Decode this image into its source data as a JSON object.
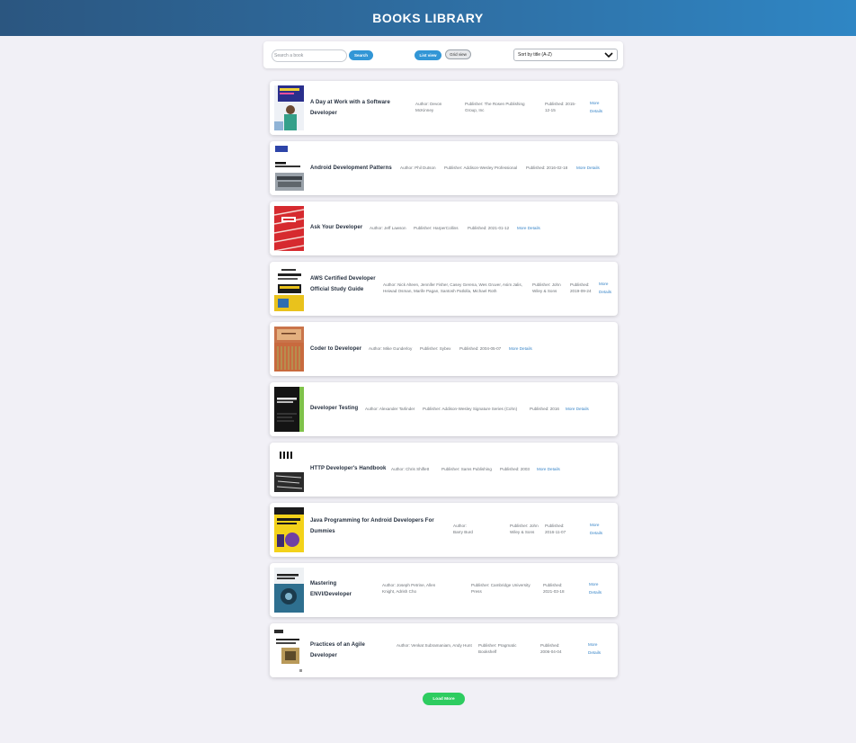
{
  "header": {
    "title": "BOOKS LIBRARY"
  },
  "toolbar": {
    "search_placeholder": "Search a book",
    "search_button": "Search",
    "list_view": "List view",
    "grid_view": "Grid view",
    "sort_selected": "Sort by title (A-Z)"
  },
  "books": [
    {
      "title": "A Day at Work with a Software Developer",
      "author": "Author: Devon McKinney",
      "publisher": "Publisher: The Rosen Publishing Group, Inc",
      "published": "Published: 2015-12-15",
      "more": "More Details"
    },
    {
      "title": "Android Development Patterns",
      "author": "Author: Phil Dutson",
      "publisher": "Publisher: Addison-Wesley Professional",
      "published": "Published: 2016-02-18",
      "more": "More Details"
    },
    {
      "title": "Ask Your Developer",
      "author": "Author: Jeff Lawson",
      "publisher": "Publisher: HarperCollins",
      "published": "Published: 2021-01-12",
      "more": "More Details"
    },
    {
      "title": "AWS Certified Developer Official Study Guide",
      "author": "Author: Nick Alteen, Jennifer Fisher, Casey Gerena, Wes Gruver, Asim Jalis, Heiwad Osman, Marife Pagan, Santosh Patlolla, Michael Roth",
      "publisher": "Publisher: John Wiley & Sons",
      "published": "Published: 2019-09-24",
      "more": "More Details"
    },
    {
      "title": "Coder to Developer",
      "author": "Author: Mike Gunderloy",
      "publisher": "Publisher: Sybex",
      "published": "Published: 2004-05-07",
      "more": "More Details"
    },
    {
      "title": "Developer Testing",
      "author": "Author: Alexander Tarlinder",
      "publisher": "Publisher: Addison-Wesley Signature Series (Cohn)",
      "published": "Published: 2016",
      "more": "More Details"
    },
    {
      "title": "HTTP Developer's Handbook",
      "author": "Author: Chris Shiflett",
      "publisher": "Publisher: Sams Publishing",
      "published": "Published: 2003",
      "more": "More Details"
    },
    {
      "title": "Java Programming for Android Developers For Dummies",
      "author": "Author: Barry Burd",
      "publisher": "Publisher: John Wiley & Sons",
      "published": "Published: 2016-11-07",
      "more": "More Details"
    },
    {
      "title": "Mastering ENVI/Developer",
      "author": "Author: Joseph Petrine, Allen Knight, Adrish Cho",
      "publisher": "Publisher: Cambridge University Press",
      "published": "Published: 2021-03-18",
      "more": "More Details"
    },
    {
      "title": "Practices of an Agile Developer",
      "author": "Author: Venkat Subramaniam, Andy Hunt",
      "publisher": "Publisher: Pragmatic Bookshelf",
      "published": "Published: 2006-04-04",
      "more": "More Details"
    }
  ],
  "load_more": "Load More"
}
